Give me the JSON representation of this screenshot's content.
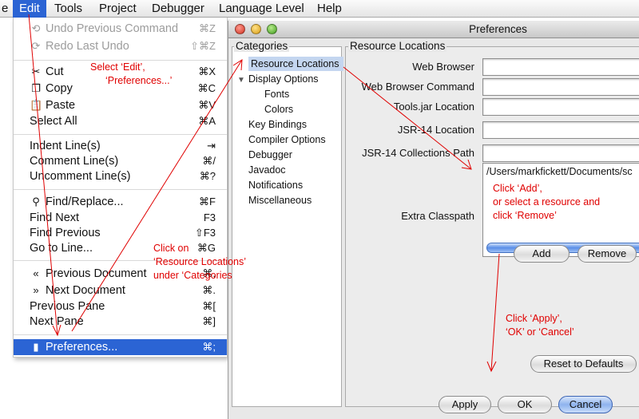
{
  "menubar": {
    "items": [
      {
        "label": "e"
      },
      {
        "label": "Edit"
      },
      {
        "label": "Tools"
      },
      {
        "label": "Project"
      },
      {
        "label": "Debugger"
      },
      {
        "label": "Language Level"
      },
      {
        "label": "Help"
      }
    ]
  },
  "edit_menu": {
    "items": [
      {
        "label": "Undo Previous Command",
        "shortcut": "⌘Z",
        "icon": "undo-icon"
      },
      {
        "label": "Redo Last Undo",
        "shortcut": "⇧⌘Z",
        "icon": "redo-icon"
      },
      {
        "label": "Cut",
        "shortcut": "⌘X",
        "icon": "scissors-icon"
      },
      {
        "label": "Copy",
        "shortcut": "⌘C",
        "icon": "copy-icon"
      },
      {
        "label": "Paste",
        "shortcut": "⌘V",
        "icon": "clipboard-icon"
      },
      {
        "label": "Select All",
        "shortcut": "⌘A"
      },
      {
        "label": "Indent Line(s)",
        "shortcut": "⇥"
      },
      {
        "label": "Comment Line(s)",
        "shortcut": "⌘/"
      },
      {
        "label": "Uncomment Line(s)",
        "shortcut": "⌘?"
      },
      {
        "label": "Find/Replace...",
        "shortcut": "⌘F",
        "icon": "binoculars-icon"
      },
      {
        "label": "Find Next",
        "shortcut": "F3"
      },
      {
        "label": "Find Previous",
        "shortcut": "⇧F3"
      },
      {
        "label": "Go to Line...",
        "shortcut": "⌘G"
      },
      {
        "label": "Previous Document",
        "shortcut": "⌘,",
        "icon": "chevron-left-icon"
      },
      {
        "label": "Next Document",
        "shortcut": "⌘.",
        "icon": "chevron-right-icon"
      },
      {
        "label": "Previous Pane",
        "shortcut": "⌘["
      },
      {
        "label": "Next Pane",
        "shortcut": "⌘]"
      },
      {
        "label": "Preferences...",
        "shortcut": "⌘;",
        "icon": "preferences-icon"
      }
    ]
  },
  "prefs_window": {
    "title": "Preferences",
    "categories_title": "Categories",
    "categories": [
      {
        "label": "Resource Locations"
      },
      {
        "label": "Display Options"
      },
      {
        "label": "Fonts"
      },
      {
        "label": "Colors"
      },
      {
        "label": "Key Bindings"
      },
      {
        "label": "Compiler Options"
      },
      {
        "label": "Debugger"
      },
      {
        "label": "Javadoc"
      },
      {
        "label": "Notifications"
      },
      {
        "label": "Miscellaneous"
      }
    ],
    "panel_title": "Resource Locations",
    "fields": [
      {
        "label": "Web Browser",
        "value": ""
      },
      {
        "label": "Web Browser Command",
        "value": ""
      },
      {
        "label": "Tools.jar Location",
        "value": ""
      },
      {
        "label": "JSR-14 Location",
        "value": ""
      },
      {
        "label": "JSR-14 Collections Path",
        "value": ""
      }
    ],
    "extra_classpath_label": "Extra Classpath",
    "extra_classpath_entry": "/Users/markfickett/Documents/sc",
    "add_label": "Add",
    "remove_label": "Remove",
    "reset_label": "Reset to Defaults",
    "apply_label": "Apply",
    "ok_label": "OK",
    "cancel_label": "Cancel"
  },
  "annotations": {
    "step1_line1": "Select ‘Edit’,",
    "step1_line2": "‘Preferences...’",
    "step2_line1": "Click on",
    "step2_line2": "‘Resource Locations’",
    "step2_line3": "under ‘Categories",
    "step3_line1": "Click ‘Add’,",
    "step3_line2": "or select a resource and",
    "step3_line3": "click ‘Remove’",
    "step4_line1": "Click ‘Apply’,",
    "step4_line2": "‘OK’ or ‘Cancel’",
    "color": "#e00000"
  }
}
